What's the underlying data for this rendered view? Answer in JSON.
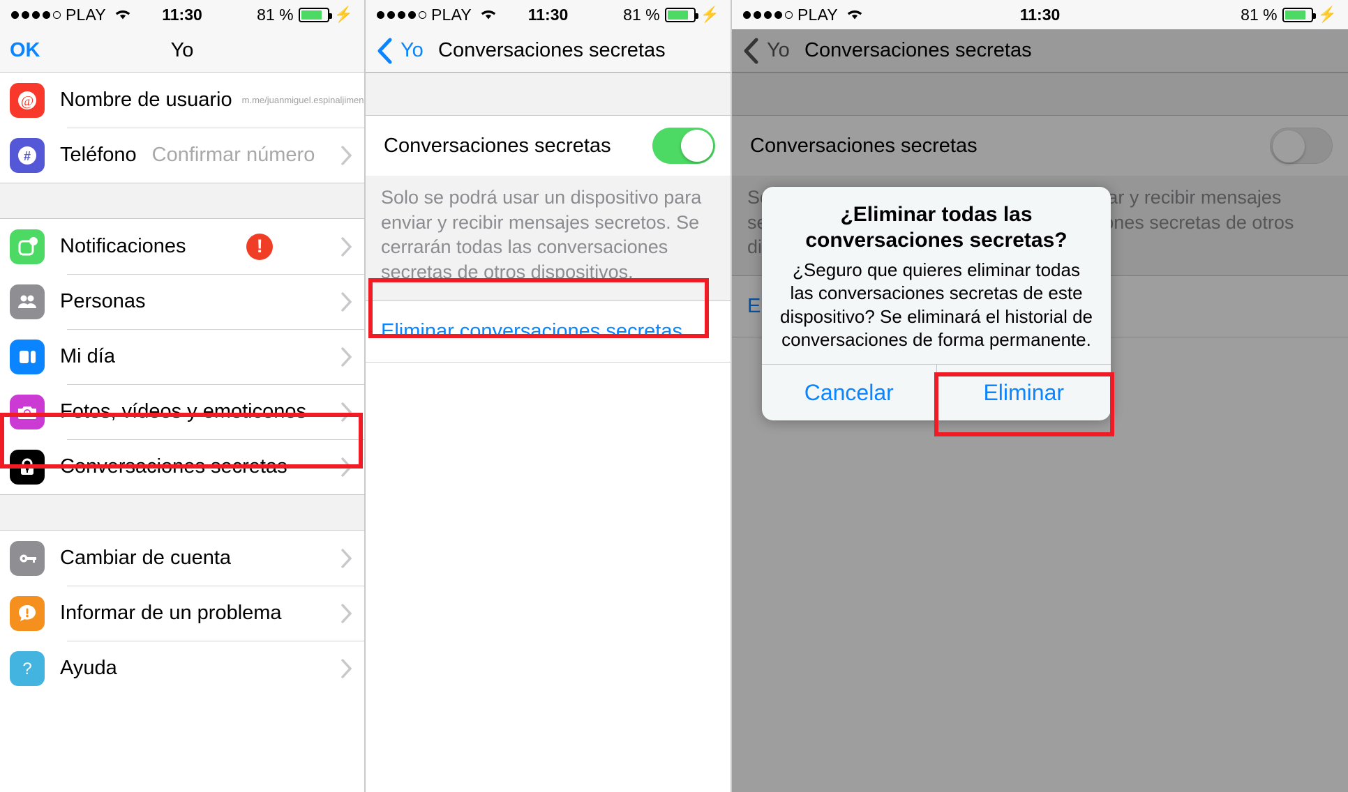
{
  "status_bar": {
    "carrier": "PLAY",
    "signal_dots_filled": 4,
    "signal_dots_total": 5,
    "wifi_icon": "wifi-icon",
    "time": "11:30",
    "battery_percent": "81 %",
    "battery_level": 81,
    "charging_icon": "lightning-bolt-icon",
    "battery_color": "#4cd964"
  },
  "colors": {
    "accent_blue": "#0a84ff",
    "highlight_red": "#ef1c25",
    "toggle_on_green": "#4cd964",
    "alert_badge_red": "#f03d25"
  },
  "panel1": {
    "nav": {
      "left_button": "OK",
      "title": "Yo"
    },
    "rows": [
      {
        "label": "Nombre de usuario",
        "sub": "m.me/juanmiguel.espinaljimenez",
        "icon": "at-sign-icon",
        "icon_color": "#f8382a",
        "chevron": true
      },
      {
        "label": "Teléfono",
        "value": "Confirmar número",
        "icon": "hash-icon",
        "icon_color": "#5558d6",
        "chevron": true
      },
      {
        "label": "Notificaciones",
        "icon": "notifications-icon",
        "icon_color": "#4cd964",
        "badge": "!",
        "chevron": true
      },
      {
        "label": "Personas",
        "icon": "people-icon",
        "icon_color": "#8e8e93",
        "chevron": true
      },
      {
        "label": "Mi día",
        "icon": "my-day-icon",
        "icon_color": "#0a84ff",
        "chevron": true
      },
      {
        "label": "Fotos, vídeos y emoticonos",
        "icon": "camera-icon",
        "icon_color": "#cc3ad4",
        "chevron": true
      },
      {
        "label": "Conversaciones secretas",
        "icon": "lock-icon",
        "icon_color": "#000000",
        "chevron": true,
        "highlighted": true
      },
      {
        "label": "Cambiar de cuenta",
        "icon": "key-icon",
        "icon_color": "#8e8e93",
        "chevron": true
      },
      {
        "label": "Informar de un problema",
        "icon": "report-problem-icon",
        "icon_color": "#f5901e",
        "chevron": true
      },
      {
        "label": "Ayuda",
        "icon": "help-icon",
        "icon_color": "#43b3e0",
        "chevron": true
      }
    ]
  },
  "panel2": {
    "nav": {
      "back_label": "Yo",
      "back_icon": "chevron-left-icon",
      "title": "Conversaciones secretas"
    },
    "setting_label": "Conversaciones secretas",
    "toggle_state": "on",
    "footnote": "Solo se podrá usar un dispositivo para enviar y recibir mensajes secretos. Se cerrarán todas las conversaciones secretas de otros dispositivos.",
    "delete_link": "Eliminar conversaciones secretas",
    "delete_link_highlighted": true
  },
  "panel3": {
    "nav": {
      "back_label": "Yo",
      "back_icon": "chevron-left-icon",
      "title": "Conversaciones secretas"
    },
    "setting_label": "Conversaciones secretas",
    "toggle_state": "off",
    "footnote": "Solo se podrá usar un dispositivo para enviar y recibir mensajes secretos. Se cerrarán todas las conversaciones secretas de otros dispositivos.",
    "delete_link": "E",
    "alert": {
      "title": "¿Eliminar todas las conversaciones secretas?",
      "message": "¿Seguro que quieres eliminar todas las conversaciones secretas de este dispositivo? Se eliminará el historial de conversaciones de forma permanente.",
      "cancel_label": "Cancelar",
      "confirm_label": "Eliminar",
      "confirm_highlighted": true
    }
  }
}
